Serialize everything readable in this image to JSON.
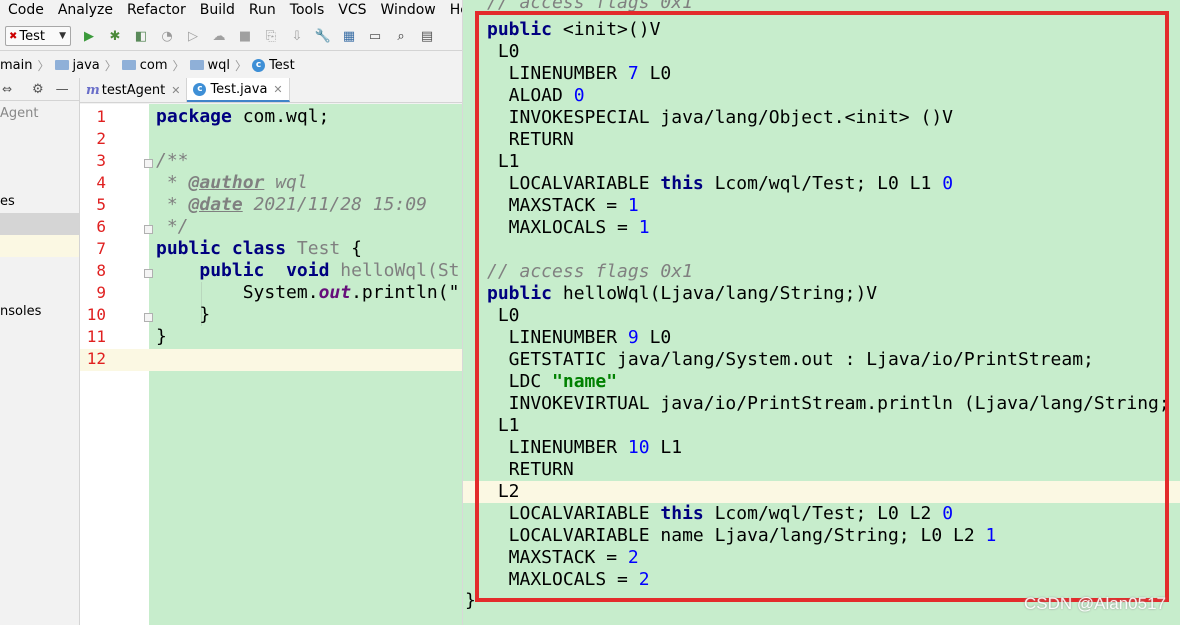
{
  "menu": [
    "Code",
    "Analyze",
    "Refactor",
    "Build",
    "Run",
    "Tools",
    "VCS",
    "Window",
    "Help"
  ],
  "toolbar": {
    "run_config": "Test"
  },
  "breadcrumb": [
    "main",
    "java",
    "com",
    "wql",
    "Test"
  ],
  "project_panel": {
    "rows": [
      "Agent",
      "es",
      "nsoles"
    ]
  },
  "tabs": [
    {
      "label": "testAgent",
      "active": false
    },
    {
      "label": "Test.java",
      "active": true
    }
  ],
  "editor": {
    "line_numbers": [
      "1",
      "2",
      "3",
      "4",
      "5",
      "6",
      "7",
      "8",
      "9",
      "10",
      "11",
      "12"
    ],
    "package_name": "com.wql;",
    "author_tag": "@author",
    "author_value": "wql",
    "date_tag": "@date",
    "date_value": "2021/11/28 15:09",
    "class_name": "Test",
    "method_name": "helloWql(St",
    "println_prefix": "System.",
    "println_field": "out",
    "println_rest": ".println(\""
  },
  "bytecode": {
    "header_comment": "// access flags 0x1",
    "init_sig": "<init>()V",
    "l0": "L0",
    "l1": "L1",
    "l2": "L2",
    "ln7": "7",
    "aload_idx": "0",
    "invokespecial": "java/lang/Object.<init> ()V",
    "return": "RETURN",
    "lv_this_1": "Lcom/wql/Test; L0 L1",
    "lv_this_1_idx": "0",
    "maxstack_1": "1",
    "maxlocals_1": "1",
    "access_comment_2": "// access flags 0x1",
    "hello_sig": "helloWql(Ljava/lang/String;)V",
    "ln9": "9",
    "getstatic": "java/lang/System.out : Ljava/io/PrintStream;",
    "ldc_value": "\"name\"",
    "invokevirtual": "java/io/PrintStream.println (Ljava/lang/String;",
    "ln10": "10",
    "lv_this_2": "Lcom/wql/Test; L0 L2",
    "lv_this_2_idx": "0",
    "lv_name": "name Ljava/lang/String; L0 L2",
    "lv_name_idx": "1",
    "maxstack_2": "2",
    "maxlocals_2": "2",
    "closing_brace": "}"
  },
  "watermark": "CSDN @Alan0517"
}
